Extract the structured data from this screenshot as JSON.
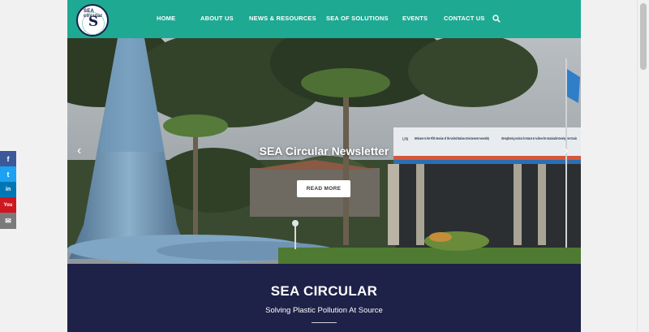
{
  "nav": {
    "items": [
      {
        "label": "HOME"
      },
      {
        "label": "ABOUT US"
      },
      {
        "label": "NEWS & RESOURCES"
      },
      {
        "label": "SEA OF SOLUTIONS"
      },
      {
        "label": "EVENTS"
      },
      {
        "label": "CONTACT US"
      }
    ],
    "search_icon": "search-icon"
  },
  "logo": {
    "text_top": "SEA circular",
    "monogram": "S"
  },
  "hero": {
    "slide_title": "SEA Circular Newsletter",
    "button_label": "READ MORE",
    "prev_arrow": "‹",
    "next_arrow": "›",
    "sign_left_text": "Welcome to the Fifth Session of the United Nations Environment Assembly",
    "sign_right_text": "Strengthening Actions for Nature to Achieve the Sustainable Development Goals",
    "sign_logo": "UN"
  },
  "banner": {
    "title": "SEA CIRCULAR",
    "subtitle": "Solving Plastic Pollution At Source"
  },
  "share": [
    {
      "icon": "facebook-icon",
      "glyph": "f",
      "color": "#3b5998"
    },
    {
      "icon": "twitter-icon",
      "glyph": "t",
      "color": "#1da1f2"
    },
    {
      "icon": "linkedin-icon",
      "glyph": "in",
      "color": "#0077b5"
    },
    {
      "icon": "youtube-icon",
      "glyph": "You",
      "color": "#cc181e"
    },
    {
      "icon": "email-icon",
      "glyph": "✉",
      "color": "#7a7a7a"
    }
  ],
  "colors": {
    "nav_bg": "#1ea993",
    "banner_bg": "#1e2148"
  }
}
